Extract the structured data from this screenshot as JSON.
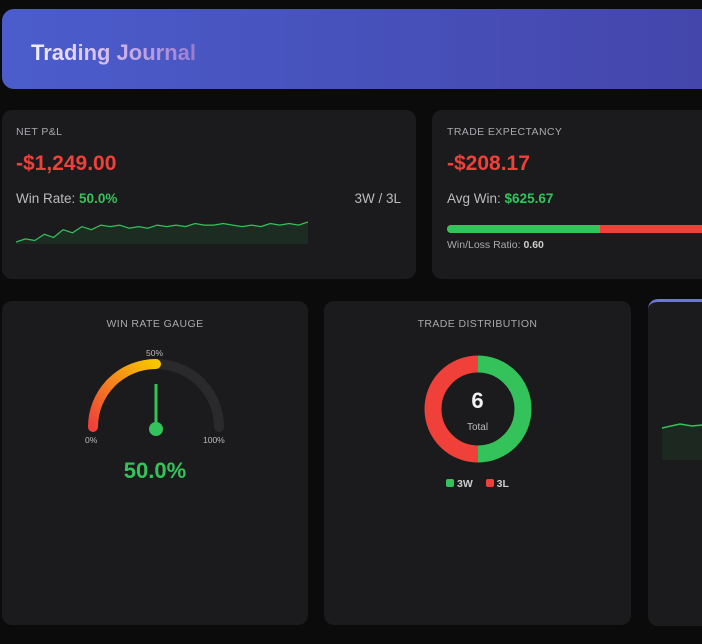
{
  "header": {
    "title": "Trading Journal"
  },
  "net_pnl": {
    "label": "NET P&L",
    "value": "-$1,249.00",
    "win_rate_label": "Win Rate:",
    "win_rate": "50.0%",
    "record": "3W / 3L",
    "sparkline": [
      2,
      4,
      3,
      7,
      5,
      10,
      8,
      12,
      10,
      13,
      12,
      13,
      11,
      12,
      11,
      13,
      12,
      13,
      12,
      14,
      13,
      13,
      14,
      13,
      12,
      13,
      12,
      14,
      13,
      14,
      13,
      15
    ]
  },
  "expectancy": {
    "label": "TRADE EXPECTANCY",
    "value": "-$208.17",
    "avg_win_label": "Avg Win:",
    "avg_win": "$625.67",
    "win_share": 0.6,
    "ratio_label": "Win/Loss Ratio:",
    "ratio": "0.60"
  },
  "gauge": {
    "label": "WIN RATE GAUGE",
    "value": "50.0%",
    "percent": 50,
    "tick_min": "0%",
    "tick_mid": "50%",
    "tick_max": "100%"
  },
  "distribution": {
    "label": "TRADE DISTRIBUTION",
    "total": "6",
    "total_label": "Total",
    "wins": 3,
    "losses": 3,
    "legend_w": "3W",
    "legend_l": "3L"
  },
  "colors": {
    "green": "#33c35a",
    "red": "#f0403a",
    "accent": "#4b5dcc"
  }
}
